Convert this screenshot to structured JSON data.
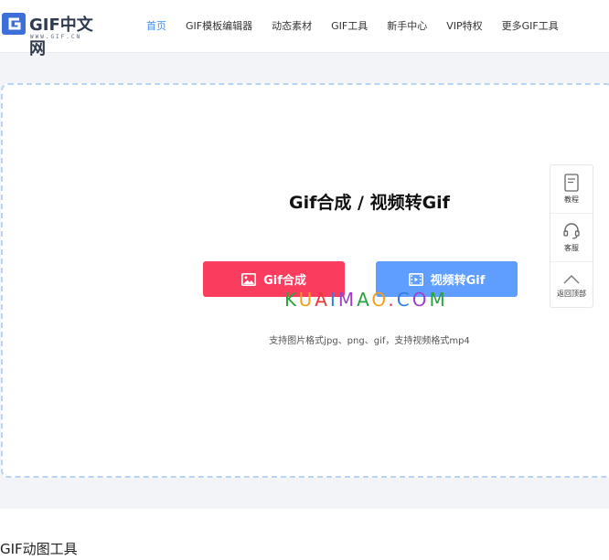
{
  "logo": {
    "text": "GIF中文网",
    "subtext": "WWW.GIF.CN"
  },
  "nav": [
    {
      "label": "首页",
      "active": true
    },
    {
      "label": "GIF模板编辑器",
      "active": false
    },
    {
      "label": "动态素材",
      "active": false
    },
    {
      "label": "GIF工具",
      "active": false
    },
    {
      "label": "新手中心",
      "active": false
    },
    {
      "label": "VIP特权",
      "active": false
    },
    {
      "label": "更多GIF工具",
      "active": false
    }
  ],
  "main": {
    "title": "Gif合成 / 视频转Gif",
    "gif_button": "Gif合成",
    "video_button": "视频转Gif",
    "hint": "支持图片格式jpg、png、gif，支持视频格式mp4",
    "watermark": "KUAIMAO.COM"
  },
  "sidebar": [
    {
      "label": "教程",
      "icon": "book-icon"
    },
    {
      "label": "客服",
      "icon": "headset-icon"
    },
    {
      "label": "返回顶部",
      "icon": "chevron-up-icon"
    }
  ],
  "bottom": {
    "title": "GIF动图工具"
  },
  "colors": {
    "accent": "#3d8bf2",
    "gif_button": "#fa3c5e",
    "video_button": "#5f9dff"
  }
}
